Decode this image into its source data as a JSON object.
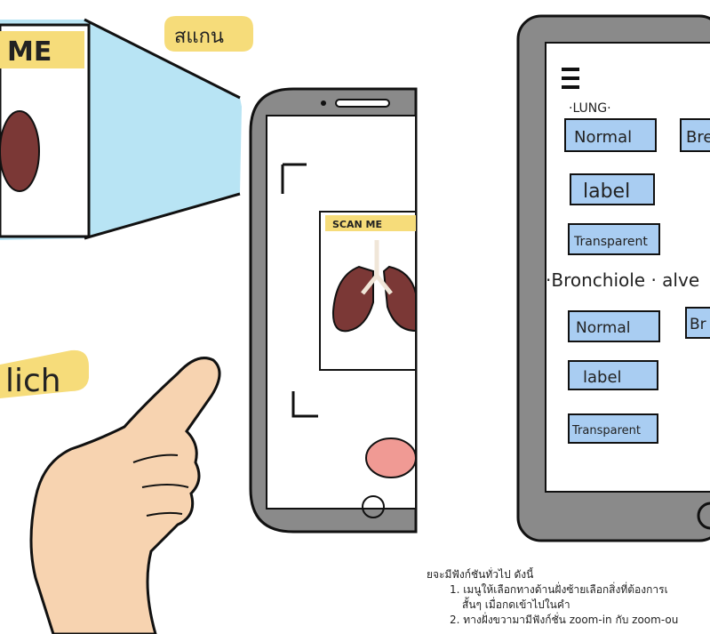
{
  "left_sketch": {
    "poster_label": "ME",
    "scan_bubble": "สแกน",
    "phone_card_label": "SCAN ME",
    "click_label": "lich"
  },
  "tablet": {
    "menu_icon": "hamburger-menu-icon",
    "lung_heading": "·LUNG·",
    "lung_buttons": [
      "Normal",
      "Bre",
      "label",
      "Transparent"
    ],
    "section_heading": "·Bronchiole · alve",
    "bronchiole_buttons": [
      "Normal",
      "Br",
      "label",
      "Transparent"
    ]
  },
  "caption": {
    "intro": "ยจะมีฟังก์ชันทั่วไป ดังนี้",
    "item1_number": "1.",
    "item1_text": "เมนูให้เลือกทางด้านฝั่งซ้ายเลือกสิ่งที่ต้องการเ",
    "item1_cont": "สั้นๆ เมื่อกดเข้าไปในคำ",
    "item2_number": "2.",
    "item2_text": "ทางฝั่งขวามามีฟังก์ชั่น zoom-in กับ zoom-ou"
  },
  "colors": {
    "highlight_yellow": "#f6dc7a",
    "beam_blue": "#b8e4f4",
    "button_blue": "#a9cdf2",
    "lung_red": "#7b3836",
    "tablet_gray": "#8a8a8a",
    "skin": "#f7d3b0",
    "home_pink": "#f09a94"
  }
}
